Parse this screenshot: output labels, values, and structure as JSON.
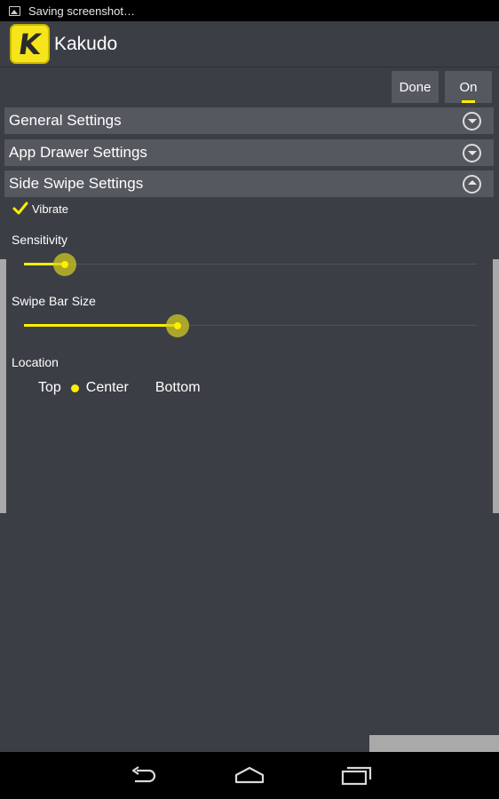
{
  "status_bar": {
    "text": "Saving screenshot…",
    "icon": "image-icon"
  },
  "app": {
    "title": "Kakudo",
    "logo_letter": "K",
    "logo_color": "#f6e51a"
  },
  "toolbar": {
    "done_label": "Done",
    "on_label": "On"
  },
  "sections": [
    {
      "label": "General Settings",
      "expanded": false
    },
    {
      "label": "App Drawer Settings",
      "expanded": false
    },
    {
      "label": "Side Swipe Settings",
      "expanded": true
    }
  ],
  "side_swipe": {
    "vibrate": {
      "label": "Vibrate",
      "checked": true
    },
    "sensitivity": {
      "label": "Sensitivity",
      "value": 0.09
    },
    "swipe_bar_size": {
      "label": "Swipe Bar Size",
      "value": 0.34
    },
    "location": {
      "label": "Location",
      "options": [
        "Top",
        "Center",
        "Bottom"
      ],
      "selected": "Center"
    }
  },
  "colors": {
    "accent": "#ffee00",
    "background": "#3b3f45",
    "header": "#55595f"
  },
  "nav_bar": {
    "icons": [
      "back-icon",
      "home-icon",
      "recent-apps-icon"
    ]
  }
}
